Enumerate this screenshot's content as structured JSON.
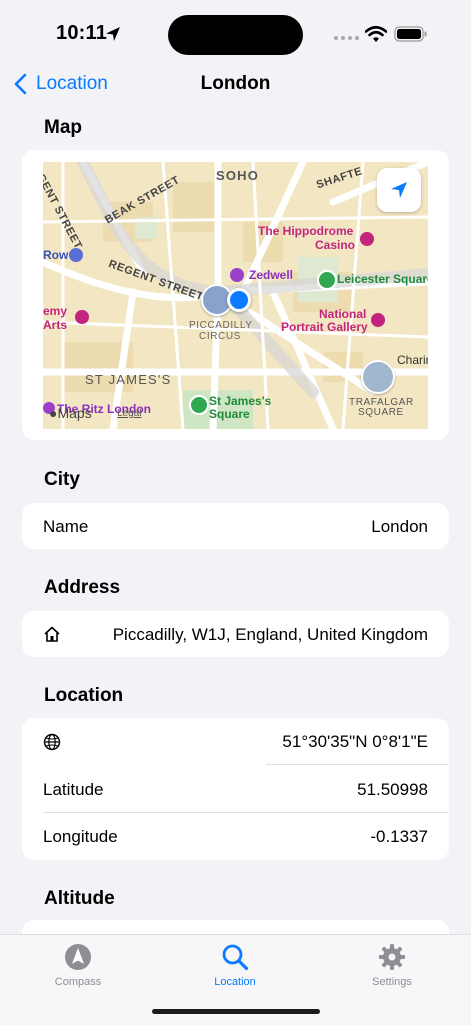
{
  "status": {
    "time": "10:11"
  },
  "nav": {
    "back_label": "Location",
    "title": "London"
  },
  "map": {
    "header": "Map",
    "labels": {
      "soho": "SOHO",
      "hippodrome": "The Hippodrome",
      "casino": "Casino",
      "zedwell": "Zedwell",
      "leicester": "Leicester Square",
      "regent_street": "REGENT STREET",
      "gent_street": "GENT STREET",
      "beak_street": "BEAK STREET",
      "shafte": "SHAFTE",
      "row": "Row",
      "emy": "emy",
      "arts": "Arts",
      "piccadilly": "PICCADILLY",
      "circus": "CIRCUS",
      "national": "National",
      "portrait": "Portrait Gallery",
      "charin": "Charin",
      "st_jamess": "ST JAMES'S",
      "st_james_sq": "St James's",
      "square": "Square",
      "trafalgar": "TRAFALGAR",
      "trafalgar_sq": "SQUARE",
      "ritz": "The Ritz London",
      "maps": "Maps",
      "legal": "Legal"
    }
  },
  "city": {
    "header": "City",
    "name_label": "Name",
    "name_value": "London"
  },
  "address": {
    "header": "Address",
    "value": "Piccadilly, W1J, England, United Kingdom"
  },
  "location": {
    "header": "Location",
    "coords": "51°30'35\"N 0°8'1\"E",
    "lat_label": "Latitude",
    "lat_value": "51.50998",
    "lon_label": "Longitude",
    "lon_value": "-0.1337"
  },
  "altitude": {
    "header": "Altitude"
  },
  "tabs": [
    {
      "label": "Compass",
      "icon": "compass-icon"
    },
    {
      "label": "Location",
      "icon": "magnifier-icon"
    },
    {
      "label": "Settings",
      "icon": "gear-icon"
    }
  ],
  "colors": {
    "accent": "#0a7aff",
    "map_base": "#f3e6c2",
    "poi": "#c2257d",
    "park": "#1f8a3a"
  }
}
